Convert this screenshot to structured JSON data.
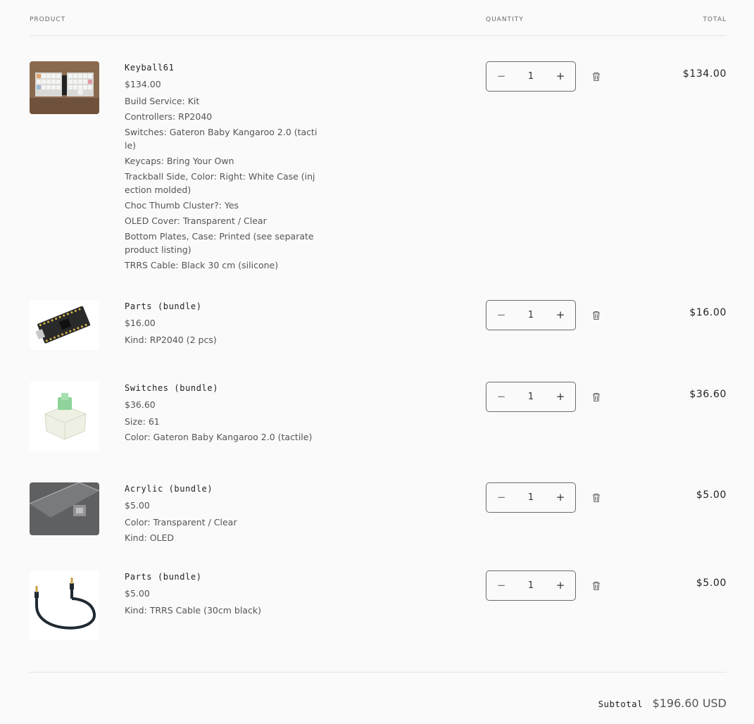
{
  "header": {
    "product": "Product",
    "quantity": "Quantity",
    "total": "Total"
  },
  "items": [
    {
      "title": "Keyball61",
      "price": "$134.00",
      "options": [
        "Build Service: Kit",
        "Controllers: RP2040",
        "Switches: Gateron Baby Kangaroo 2.0 (tactile)",
        "Keycaps: Bring Your Own",
        "Trackball Side, Color: Right: White Case (injection molded)",
        "Choc Thumb Cluster?: Yes",
        "OLED Cover: Transparent / Clear",
        "Bottom Plates, Case: Printed (see separate product listing)",
        "TRRS Cable: Black 30 cm (silicone)"
      ],
      "quantity": "1",
      "total": "$134.00",
      "image": "keyboard-photo"
    },
    {
      "title": "Parts (bundle)",
      "price": "$16.00",
      "options": [
        "Kind: RP2040 (2 pcs)"
      ],
      "quantity": "1",
      "total": "$16.00",
      "image": "rp2040-board-photo"
    },
    {
      "title": "Switches (bundle)",
      "price": "$36.60",
      "options": [
        "Size: 61",
        "Color: Gateron Baby Kangaroo 2.0 (tactile)"
      ],
      "quantity": "1",
      "total": "$36.60",
      "image": "switch-photo"
    },
    {
      "title": "Acrylic (bundle)",
      "price": "$5.00",
      "options": [
        "Color: Transparent / Clear",
        "Kind: OLED"
      ],
      "quantity": "1",
      "total": "$5.00",
      "image": "acrylic-photo"
    },
    {
      "title": "Parts (bundle)",
      "price": "$5.00",
      "options": [
        "Kind: TRRS Cable (30cm black)"
      ],
      "quantity": "1",
      "total": "$5.00",
      "image": "trrs-cable-photo"
    }
  ],
  "controls": {
    "minus": "−",
    "plus": "+"
  },
  "subtotal": {
    "label": "Subtotal",
    "value": "$196.60 USD"
  },
  "icons": {
    "remove": "trash-icon",
    "decrease": "minus-icon",
    "increase": "plus-icon"
  }
}
